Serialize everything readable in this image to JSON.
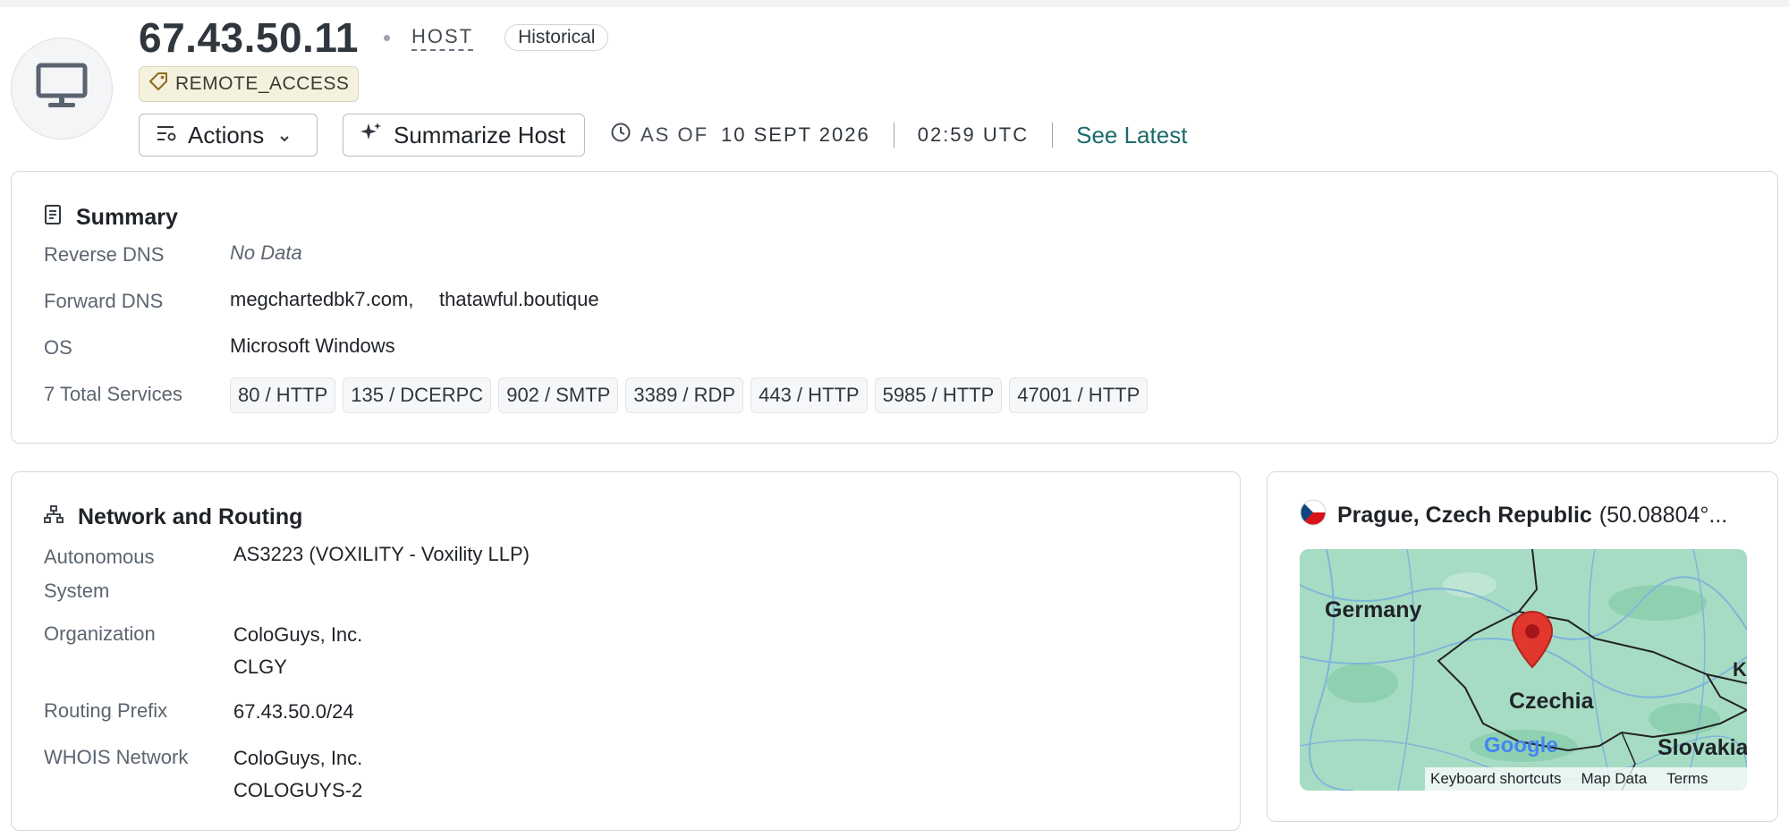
{
  "header": {
    "ip": "67.43.50.11",
    "host_label": "HOST",
    "status_badge": "Historical",
    "tag": "REMOTE_ACCESS",
    "actions_label": "Actions",
    "summarize_label": "Summarize Host",
    "as_of_label": "AS OF",
    "as_of_date": "10 SEPT 2026",
    "as_of_time": "02:59 UTC",
    "see_latest": "See Latest"
  },
  "summary": {
    "title": "Summary",
    "reverse_dns_label": "Reverse DNS",
    "reverse_dns_value": "No Data",
    "forward_dns_label": "Forward DNS",
    "forward_dns_values": [
      "megchartedbk7.com,",
      "thatawful.boutique"
    ],
    "os_label": "OS",
    "os_value": "Microsoft Windows",
    "services_label": "7 Total Services",
    "services": [
      "80 / HTTP",
      "135 / DCERPC",
      "902 / SMTP",
      "3389 / RDP",
      "443 / HTTP",
      "5985 / HTTP",
      "47001 / HTTP"
    ]
  },
  "network": {
    "title": "Network and Routing",
    "as_label_line1": "Autonomous",
    "as_label_line2": "System",
    "as_value": "AS3223 (VOXILITY - Voxility LLP)",
    "org_label": "Organization",
    "org_value_line1": "ColoGuys, Inc.",
    "org_value_line2": "CLGY",
    "prefix_label": "Routing Prefix",
    "prefix_value": "67.43.50.0/24",
    "whois_label": "WHOIS Network",
    "whois_value_line1": "ColoGuys, Inc.",
    "whois_value_line2": "COLOGUYS-2"
  },
  "location": {
    "city": "Prague, Czech Republic",
    "coords": "(50.08804°...",
    "map_labels": {
      "germany": "Germany",
      "czechia": "Czechia",
      "slovakia": "Slovakia",
      "edge_k": "K",
      "google": "Google"
    },
    "map_footer": {
      "shortcuts": "Keyboard shortcuts",
      "map_data": "Map Data",
      "terms": "Terms"
    }
  },
  "colors": {
    "accent_link": "#1b6b6b",
    "tag_bg": "#f5f1df",
    "map_pin": "#e2372f",
    "map_land": "#a7dcc4"
  }
}
